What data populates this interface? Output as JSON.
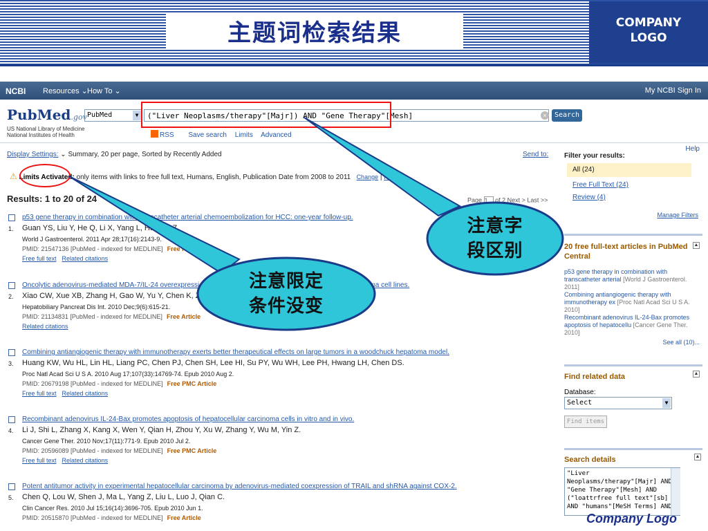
{
  "slide": {
    "title": "主题词检索结果",
    "logo_line1": "COMPANY",
    "logo_line2": "LOGO",
    "footer_logo": "Company Logo"
  },
  "ncbi_bar": {
    "logo": "NCBI",
    "resources": "Resources ⌄",
    "howto": "How To ⌄",
    "right": "My NCBI  Sign In"
  },
  "pubmed": {
    "logo": "PubMed",
    "logo_suffix": ".gov",
    "lib_line1": "US National Library of Medicine",
    "lib_line2": "National Institutes of Health",
    "db_selected": "PubMed",
    "query": "(\"Liver Neoplasms/therapy\"[Majr]) AND \"Gene Therapy\"[Mesh]",
    "search_label": "Search",
    "links": [
      "RSS",
      "Save search",
      "Limits",
      "Advanced"
    ],
    "help": "Help"
  },
  "display": {
    "settings_link": "Display Settings:",
    "settings_text": "Summary, 20 per page, Sorted by Recently Added",
    "send_to": "Send to:"
  },
  "limits": {
    "label": "Limits Activated:",
    "text": "only items with links to free full text, Humans, English, Publication Date from 2008 to 2011",
    "change": "Change",
    "remove": "Remove"
  },
  "results_count": "Results: 1 to 20 of 24",
  "pager": {
    "page_label": "Page",
    "page_value": "1",
    "of": "of 2",
    "next": "Next >",
    "last": "Last >>"
  },
  "results": [
    {
      "num": "1.",
      "title": "p53 gene therapy in combination with transcatheter arterial chemoembolization for HCC: one-year follow-up.",
      "authors": "Guan YS, Liu Y, He Q, Li X, Yang L, Hu Y, Li Z.",
      "journal": "World J Gastroenterol. 2011 Apr 28;17(16):2143-9.",
      "pmid": "PMID: 21547136 [PubMed - indexed for MEDLINE]",
      "free": "Free PMC Article",
      "links": [
        "Free full text",
        "Related citations"
      ]
    },
    {
      "num": "2.",
      "title": "Oncolytic adenovirus-mediated MDA-7/IL-24 overexpression enhances antitumor activity of hepatocellular carcinoma cell lines.",
      "authors": "Xiao CW, Xue XB, Zhang H, Gao W, Yu Y, Chen K, Zheng JW, Wu MC.",
      "journal": "Hepatobiliary Pancreat Dis Int. 2010 Dec;9(6):615-21.",
      "pmid": "PMID: 21134831 [PubMed - indexed for MEDLINE]",
      "free": "Free Article",
      "links": [
        "Related citations"
      ]
    },
    {
      "num": "3.",
      "title": "Combining antiangiogenic therapy with immunotherapy exerts better therapeutical effects on large tumors in a woodchuck hepatoma model.",
      "authors": "Huang KW, Wu HL, Lin HL, Liang PC, Chen PJ, Chen SH, Lee HI, Su PY, Wu WH, Lee PH, Hwang LH, Chen DS.",
      "journal": "Proc Natl Acad Sci U S A. 2010 Aug 17;107(33):14769-74. Epub 2010 Aug 2.",
      "pmid": "PMID: 20679198 [PubMed - indexed for MEDLINE]",
      "free": "Free PMC Article",
      "links": [
        "Free full text",
        "Related citations"
      ]
    },
    {
      "num": "4.",
      "title": "Recombinant adenovirus IL-24-Bax promotes apoptosis of hepatocellular carcinoma cells in vitro and in vivo.",
      "authors": "Li J, Shi L, Zhang X, Kang X, Wen Y, Qian H, Zhou Y, Xu W, Zhang Y, Wu M, Yin Z.",
      "journal": "Cancer Gene Ther. 2010 Nov;17(11):771-9. Epub 2010 Jul 2.",
      "pmid": "PMID: 20596089 [PubMed - indexed for MEDLINE]",
      "free": "Free PMC Article",
      "links": [
        "Free full text",
        "Related citations"
      ]
    },
    {
      "num": "5.",
      "title": "Potent antitumor activity in experimental hepatocellular carcinoma by adenovirus-mediated coexpression of TRAIL and shRNA against COX-2.",
      "authors": "Chen Q, Lou W, Shen J, Ma L, Yang Z, Liu L, Luo J, Qian C.",
      "journal": "Clin Cancer Res. 2010 Jul 15;16(14):3696-705. Epub 2010 Jun 1.",
      "pmid": "PMID: 20515870 [PubMed - indexed for MEDLINE]",
      "free": "Free Article",
      "links": []
    }
  ],
  "sidebar": {
    "filter_title": "Filter your results:",
    "filter_all": "All (24)",
    "filter_items": [
      "Free Full Text (24)",
      "Review (4)"
    ],
    "manage": "Manage Filters",
    "pmc_head": "20 free full-text articles in PubMed Central",
    "pmc_items": [
      {
        "t": "p53 gene therapy in combination with transcatheter arterial",
        "s": "[World J Gastroenterol. 2011]"
      },
      {
        "t": "Combining antiangiogenic therapy with immunotherapy ex",
        "s": "[Proc Natl Acad Sci U S A. 2010]"
      },
      {
        "t": "Recombinant adenovirus IL-24-Bax promotes apoptosis of hepatocellu",
        "s": "[Cancer Gene Ther. 2010]"
      }
    ],
    "see_all": "See all (10)...",
    "related_head": "Find related data",
    "db_label": "Database:",
    "db_value": "Select",
    "find_items": "Find items",
    "details_head": "Search details",
    "details_text": "\"Liver\nNeoplasms/therapy\"[Majr] AND\n\"Gene Therapy\"[Mesh] AND\n(\"loattrfree full text\"[sb]\nAND \"humans\"[MeSH Terms] AND"
  },
  "callouts": {
    "field": [
      "注意字",
      "段区别"
    ],
    "limits": [
      "注意限定",
      "条件没变"
    ]
  },
  "colors": {
    "header_blue": "#2d53a6",
    "title_blue": "#1a2f8c",
    "callout_fill": "#2ec6d8",
    "callout_stroke": "#1a3a8a",
    "highlight_red": "#ee1111",
    "link_blue": "#2558a8"
  }
}
